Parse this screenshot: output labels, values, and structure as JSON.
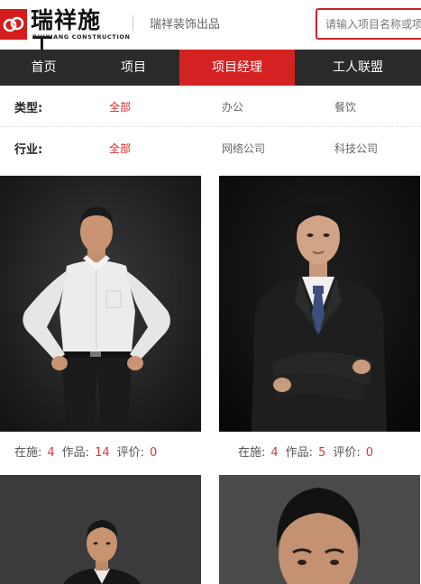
{
  "header": {
    "logo_text": "瑞祥施工",
    "logo_sub": "RUIXIANG CONSTRUCTION",
    "tagline": "瑞祥装饰出品",
    "search_placeholder": "请输入项目名称或项目经理"
  },
  "nav": {
    "items": [
      {
        "label": "首页"
      },
      {
        "label": "项目"
      },
      {
        "label": "项目经理",
        "active": true
      },
      {
        "label": "工人联盟"
      }
    ]
  },
  "filters": {
    "type": {
      "label": "类型:",
      "options": [
        "全部",
        "办公",
        "餐饮"
      ],
      "selected": "全部"
    },
    "industry": {
      "label": "行业:",
      "options": [
        "全部",
        "网络公司",
        "科技公司"
      ],
      "selected": "全部"
    }
  },
  "managers": [
    {
      "ongoing_label": "在施:",
      "ongoing": "4",
      "works_label": "作品:",
      "works": "14",
      "rating_label": "评价:",
      "rating": "0"
    },
    {
      "ongoing_label": "在施:",
      "ongoing": "4",
      "works_label": "作品:",
      "works": "5",
      "rating_label": "评价:",
      "rating": "0"
    },
    {},
    {}
  ],
  "colors": {
    "brand_red": "#d42222",
    "nav_bg": "#2a2a2a",
    "active_filter": "#d42a2a"
  }
}
